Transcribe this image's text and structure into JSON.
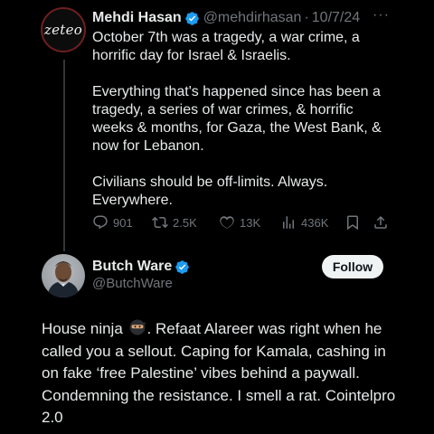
{
  "tweet1": {
    "avatar_text": "zeteo",
    "name": "Mehdi Hasan",
    "handle": "@mehdirhasan",
    "separator": "·",
    "date": "10/7/24",
    "more": "···",
    "paragraphs": [
      "October 7th was a tragedy, a war crime, a horrific day for Israel & Israelis.",
      "Everything that's happened since has been a tragedy, a series of war crimes, & horrific weeks & months, for Gaza, the West Bank, & now for Lebanon.",
      "Civilians should be off-limits. Always. Everywhere."
    ],
    "stats": {
      "replies": "901",
      "reposts": "2.5K",
      "likes": "13K",
      "views": "436K"
    }
  },
  "tweet2": {
    "name": "Butch Ware",
    "handle": "@ButchWare",
    "follow_label": "Follow",
    "body_before_emoji": "House ninja ",
    "emoji": "ninja-emoji",
    "body_after_emoji": ". Refaat Alareer was right when he called you a sellout. Caping for Kamala, cashing in on fake ‘free Palestine’ vibes behind a paywall. Condemning the resistance. I smell a rat. Cointelpro 2.0"
  },
  "colors": {
    "background": "#000000",
    "text": "#e7e9ea",
    "muted": "#71767b",
    "verified": "#1d9bf0",
    "follow_bg": "#eff3f4"
  }
}
